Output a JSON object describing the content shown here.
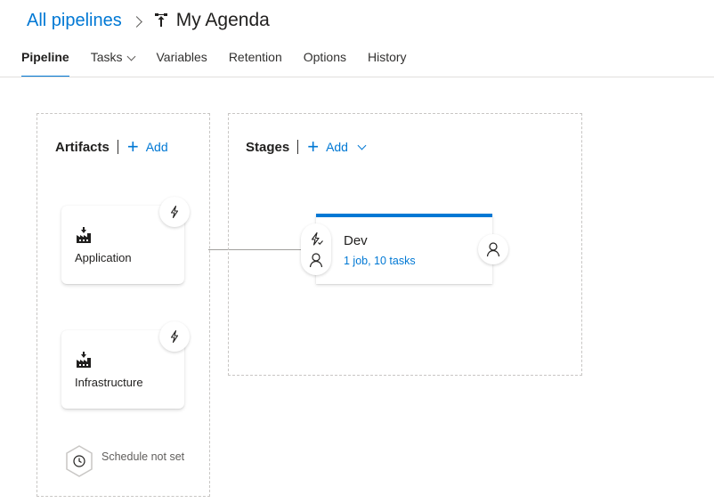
{
  "breadcrumb": {
    "root": "All pipelines",
    "title": "My Agenda"
  },
  "tabs": [
    {
      "label": "Pipeline",
      "active": true
    },
    {
      "label": "Tasks",
      "dropdown": true
    },
    {
      "label": "Variables"
    },
    {
      "label": "Retention"
    },
    {
      "label": "Options"
    },
    {
      "label": "History"
    }
  ],
  "artifacts": {
    "title": "Artifacts",
    "add_label": "Add",
    "items": [
      {
        "label": "Application",
        "icon": "build-artifact-icon",
        "trigger_icon": "lightning-icon"
      },
      {
        "label": "Infrastructure",
        "icon": "build-artifact-icon",
        "trigger_icon": "lightning-icon"
      }
    ],
    "schedule_label": "Schedule not set"
  },
  "stages": {
    "title": "Stages",
    "add_label": "Add",
    "items": [
      {
        "name": "Dev",
        "summary": "1 job, 10 tasks"
      }
    ]
  },
  "colors": {
    "accent": "#0078d4",
    "text": "#201f1e",
    "border": "#c8c6c4"
  }
}
